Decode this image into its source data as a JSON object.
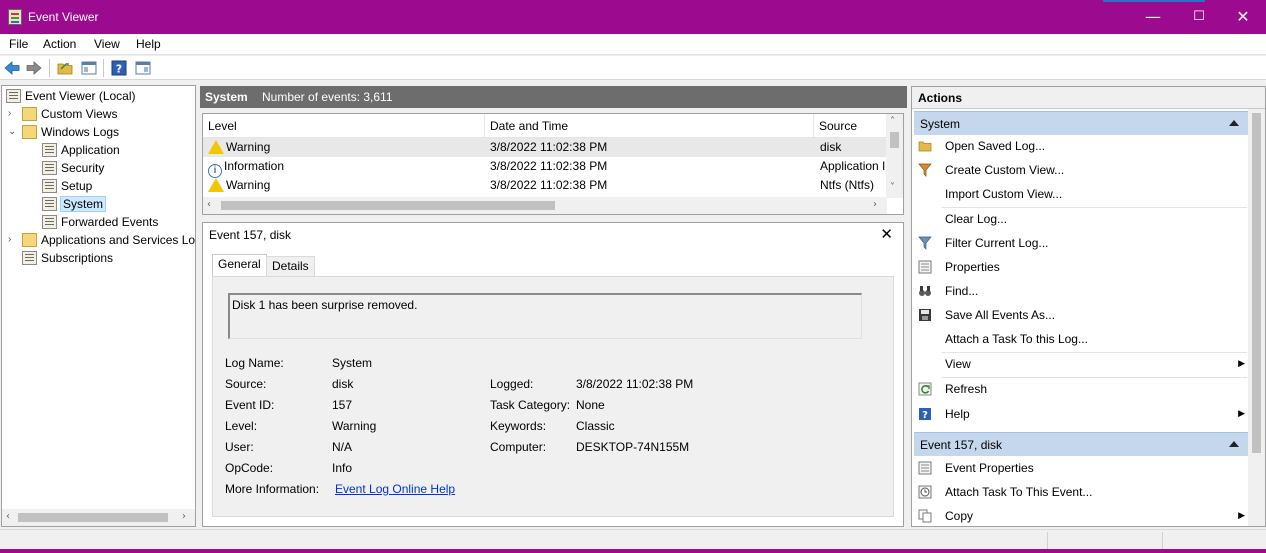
{
  "window": {
    "title": "Event Viewer",
    "accent_color": "#9c0a8f",
    "controls": {
      "minimize": "—",
      "maximize": "☐",
      "close": "✕"
    }
  },
  "menu": [
    "File",
    "Action",
    "View",
    "Help"
  ],
  "toolbar": [
    "back-arrow-icon",
    "forward-arrow-icon",
    "open-folder-icon",
    "show-hide-console-tree-icon",
    "help-icon",
    "show-hide-action-pane-icon"
  ],
  "tree": {
    "items": [
      {
        "label": "Event Viewer (Local)",
        "icon": "event-viewer-icon"
      },
      {
        "label": "Custom Views",
        "icon": "folder-icon",
        "expander": "›"
      },
      {
        "label": "Windows Logs",
        "icon": "folder-icon",
        "expander": "⌄"
      },
      {
        "label": "Application",
        "icon": "log-icon"
      },
      {
        "label": "Security",
        "icon": "log-icon"
      },
      {
        "label": "Setup",
        "icon": "log-icon"
      },
      {
        "label": "System",
        "icon": "log-icon",
        "selected": true
      },
      {
        "label": "Forwarded Events",
        "icon": "log-icon"
      },
      {
        "label": "Applications and Services Lo",
        "icon": "folder-icon",
        "expander": "›"
      },
      {
        "label": "Subscriptions",
        "icon": "subscriptions-icon"
      }
    ]
  },
  "center": {
    "log_name": "System",
    "event_count": "Number of events: 3,611",
    "columns": [
      "Level",
      "Date and Time",
      "Source"
    ],
    "rows": [
      {
        "level": "Warning",
        "icon": "warning-icon",
        "datetime": "3/8/2022 11:02:38 PM",
        "source": "disk",
        "selected": true
      },
      {
        "level": "Information",
        "icon": "information-icon",
        "datetime": "3/8/2022 11:02:38 PM",
        "source": "Application I"
      },
      {
        "level": "Warning",
        "icon": "warning-icon",
        "datetime": "3/8/2022 11:02:38 PM",
        "source": "Ntfs (Ntfs)"
      }
    ]
  },
  "detail": {
    "title": "Event 157, disk",
    "close": "✕",
    "tabs": [
      "General",
      "Details"
    ],
    "message": "Disk 1 has been surprise removed.",
    "fields": {
      "log_name_label": "Log Name:",
      "log_name": "System",
      "source_label": "Source:",
      "source": "disk",
      "logged_label": "Logged:",
      "logged": "3/8/2022 11:02:38 PM",
      "event_id_label": "Event ID:",
      "event_id": "157",
      "task_category_label": "Task Category:",
      "task_category": "None",
      "level_label": "Level:",
      "level": "Warning",
      "keywords_label": "Keywords:",
      "keywords": "Classic",
      "user_label": "User:",
      "user": "N/A",
      "computer_label": "Computer:",
      "computer": "DESKTOP-74N155M",
      "opcode_label": "OpCode:",
      "opcode": "Info",
      "more_info_label": "More Information:",
      "more_info_link": "Event Log Online Help"
    }
  },
  "actions": {
    "title": "Actions",
    "groups": [
      {
        "label": "System",
        "items": [
          {
            "label": "Open Saved Log...",
            "icon": "open-folder-icon"
          },
          {
            "label": "Create Custom View...",
            "icon": "filter-icon"
          },
          {
            "label": "Import Custom View...",
            "icon": ""
          },
          {
            "label": "Clear Log...",
            "icon": ""
          },
          {
            "label": "Filter Current Log...",
            "icon": "filter-icon"
          },
          {
            "label": "Properties",
            "icon": "properties-icon"
          },
          {
            "label": "Find...",
            "icon": "binoculars-icon"
          },
          {
            "label": "Save All Events As...",
            "icon": "save-icon"
          },
          {
            "label": "Attach a Task To this Log...",
            "icon": ""
          },
          {
            "label": "View",
            "icon": "",
            "submenu": true
          },
          {
            "label": "Refresh",
            "icon": "refresh-icon"
          },
          {
            "label": "Help",
            "icon": "help-icon",
            "submenu": true
          }
        ]
      },
      {
        "label": "Event 157, disk",
        "items": [
          {
            "label": "Event Properties",
            "icon": "properties-icon"
          },
          {
            "label": "Attach Task To This Event...",
            "icon": "task-clock-icon"
          },
          {
            "label": "Copy",
            "icon": "copy-icon",
            "submenu": true
          }
        ]
      }
    ]
  }
}
